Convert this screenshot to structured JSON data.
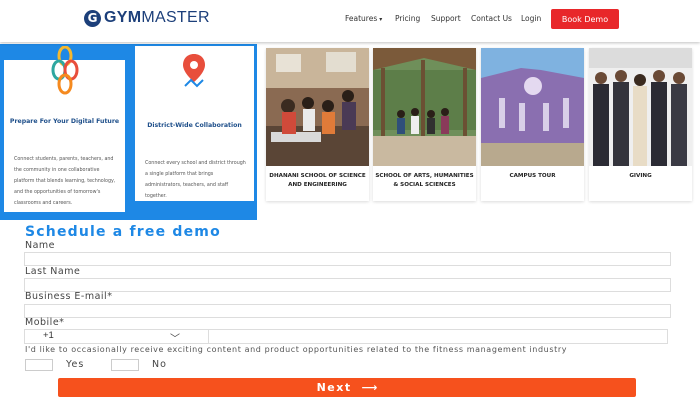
{
  "header": {
    "logo_mark": "G",
    "logo_text_bold": "GYM",
    "logo_text_rest": "MASTER",
    "nav": [
      {
        "label": "Features",
        "has_caret": true
      },
      {
        "label": "Pricing"
      },
      {
        "label": "Support"
      },
      {
        "label": "Contact Us"
      },
      {
        "label": "Login"
      }
    ],
    "cta_label": "Book Demo",
    "caret_icon": "▾"
  },
  "colors": {
    "brand_navy": "#1c3f7a",
    "panel_blue": "#1e88e5",
    "cta_red": "#e8272a",
    "next_orange": "#f6511d"
  },
  "cards": [
    {
      "title": "Prepare For Your Digital Future",
      "icon": "puzzle-chain-icon",
      "body": "Connect students, parents, teachers, and the community in one collaborative platform that blends learning, technology, and the opportunities of tomorrow's classrooms and careers."
    },
    {
      "title": "District-Wide Collaboration",
      "icon": "map-pin-icon",
      "body": "Connect every school and district through a single platform that brings administrators, teachers, and staff together."
    }
  ],
  "tiles": [
    {
      "caption": "DHANANI SCHOOL OF SCIENCE AND ENGINEERING",
      "image": "lab-students-photo"
    },
    {
      "caption": "SCHOOL OF ARTS, HUMANITIES & SOCIAL SCIENCES",
      "image": "pavilion-students-photo"
    },
    {
      "caption": "CAMPUS TOUR",
      "image": "campus-building-photo"
    },
    {
      "caption": "GIVING",
      "image": "donors-group-photo"
    }
  ],
  "form": {
    "title": "Schedule a free demo",
    "name_label": "Name",
    "last_name_label": "Last Name",
    "email_label": "Business E-mail*",
    "mobile_label": "Mobile*",
    "country_code": "+1",
    "chevron_icon": "﹀",
    "consent_text": "I'd like to occasionally receive exciting content and product opportunities related to the fitness management industry",
    "yes_label": "Yes",
    "no_label": "No",
    "next_label": "Next",
    "next_arrow": "⟶"
  }
}
